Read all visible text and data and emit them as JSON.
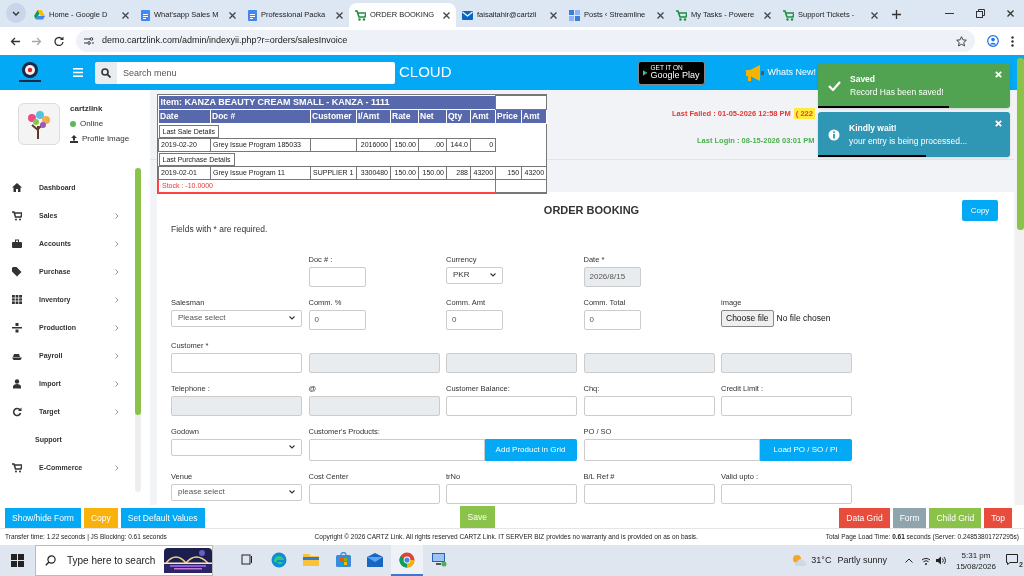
{
  "browser": {
    "tabs": [
      {
        "title": "Home - Google D",
        "kind": "drive",
        "selected": false
      },
      {
        "title": "What'sapp Sales M",
        "kind": "doc",
        "selected": false
      },
      {
        "title": "Professional Packa",
        "kind": "doc",
        "selected": false
      },
      {
        "title": "ORDER BOOKING",
        "kind": "cart",
        "selected": true
      },
      {
        "title": "faisaltahir@cartzli",
        "kind": "mail",
        "selected": false
      },
      {
        "title": "Posts ‹ Streamline",
        "kind": "site",
        "selected": false
      },
      {
        "title": "My Tasks - Powere",
        "kind": "cart",
        "selected": false
      },
      {
        "title": "Support Tickets - ",
        "kind": "cart",
        "selected": false
      }
    ],
    "url": "demo.cartzlink.com/admin/indexyii.php?r=orders/salesInvoice"
  },
  "header": {
    "search_placeholder": "Search menu",
    "cloud": "CLOUD",
    "play_small": "GET IT ON",
    "play_big": "Google Play",
    "whats_new": "Whats New!"
  },
  "sidebar": {
    "user": "cartzlink",
    "status": "Online",
    "profile_link": "Profile Image",
    "items": [
      {
        "label": "Dashboard",
        "kind": "home",
        "has_submenu": false
      },
      {
        "label": "Sales",
        "kind": "cart",
        "has_submenu": true
      },
      {
        "label": "Accounts",
        "kind": "briefcase",
        "has_submenu": true
      },
      {
        "label": "Purchase",
        "kind": "tag",
        "has_submenu": true
      },
      {
        "label": "Inventory",
        "kind": "grid",
        "has_submenu": true
      },
      {
        "label": "Production",
        "kind": "sitemap",
        "has_submenu": true
      },
      {
        "label": "Payroll",
        "kind": "ship",
        "has_submenu": true
      },
      {
        "label": "Import",
        "kind": "user",
        "has_submenu": true
      },
      {
        "label": "Target",
        "kind": "refresh",
        "has_submenu": true
      },
      {
        "label": "Support",
        "kind": "none",
        "has_submenu": false
      },
      {
        "label": "E-Commerce",
        "kind": "cart",
        "has_submenu": true
      }
    ]
  },
  "item_popup": {
    "title": "Item: KANZA BEAUTY CREAM SMALL - KANZA - 1111",
    "columns": [
      "Date",
      "Doc #",
      "Customer",
      "I/Amt",
      "Rate",
      "Net",
      "Qty",
      "Amt",
      "Price",
      "Amt"
    ],
    "sections": [
      {
        "label": "Last Sale Details",
        "row": {
          "date": "2019-02-20",
          "doc_no": "Grey Issue Program 185033",
          "i_amt": "2016000",
          "rate": "150.00",
          "net": ".00",
          "qty": "144.0",
          "amt": "0"
        }
      },
      {
        "label": "Last Purchase Details",
        "row": {
          "date": "2019-02-01",
          "doc_no": "Grey Issue Program 11",
          "customer": "SUPPLIER 1",
          "i_amt": "3300480",
          "rate": "150.00",
          "net": "150.00",
          "qty": "288",
          "amt": "43200",
          "price": "150",
          "price_amt": "43200"
        }
      }
    ],
    "stock": "Stock : -10.0000"
  },
  "login_info": {
    "failed": "Last Failed : 01-05-2026 12:58 PM",
    "failed_days": "( 222",
    "last_login": "Last Login : 08-15-2026 03:01 PM"
  },
  "toasts": [
    {
      "kind": "success",
      "title": "Saved",
      "message": "Record Has been saved!",
      "level": 0.68
    },
    {
      "kind": "info",
      "title": "Kindly wait!",
      "message": "your entry is being processed...",
      "level": 0.56
    }
  ],
  "form": {
    "title": "ORDER BOOKING",
    "copy": "Copy",
    "note": "Fields with * are required.",
    "rows": [
      [
        {
          "kind": "blank"
        },
        {
          "kind": "small_input",
          "label": "Doc # :"
        },
        {
          "kind": "small_select",
          "label": "Currency",
          "value": "PKR"
        },
        {
          "kind": "small_readonly",
          "label": "Date *",
          "value": "2026/8/15"
        },
        {
          "kind": "blank"
        }
      ],
      [
        {
          "kind": "select",
          "label": "Salesman",
          "value": "Please select"
        },
        {
          "kind": "small_input",
          "label": "Comm. %",
          "value": "0"
        },
        {
          "kind": "small_input",
          "label": "Comm. Amt",
          "value": "0"
        },
        {
          "kind": "small_input",
          "label": "Comm. Total",
          "value": "0"
        },
        {
          "kind": "file",
          "label": "image",
          "button": "Choose file",
          "value": "No file chosen"
        }
      ],
      [
        {
          "kind": "input",
          "label": "Customer *"
        },
        {
          "kind": "readonly"
        },
        {
          "kind": "readonly"
        },
        {
          "kind": "readonly"
        },
        {
          "kind": "readonly"
        }
      ],
      [
        {
          "kind": "readonly",
          "label": "Telephone :"
        },
        {
          "kind": "readonly",
          "label": "@"
        },
        {
          "kind": "input",
          "label": "Customer Balance:"
        },
        {
          "kind": "input",
          "label": "Chq:"
        },
        {
          "kind": "input",
          "label": "Credit Limit :"
        }
      ],
      [
        {
          "kind": "select",
          "label": "Godown"
        },
        {
          "kind": "wide_input",
          "label": "Customer's Products:"
        },
        {
          "kind": "button",
          "button": "Add Product in Grid"
        },
        {
          "kind": "wide_input",
          "label": "PO / SO"
        },
        {
          "kind": "button",
          "button": "Load PO / SO / PI"
        }
      ],
      [
        {
          "kind": "select",
          "label": "Venue",
          "value": "please select"
        },
        {
          "kind": "input",
          "label": "Cost Center"
        },
        {
          "kind": "input",
          "label": "trNo"
        },
        {
          "kind": "input",
          "label": "B/L Ref #"
        },
        {
          "kind": "input",
          "label": "Valid upto :"
        }
      ]
    ]
  },
  "actions": {
    "left": [
      {
        "label": "Show/hide Form",
        "kind": "primary"
      },
      {
        "label": "Copy",
        "kind": "warning"
      },
      {
        "label": "Set Default Values",
        "kind": "primary"
      }
    ],
    "save": "Save",
    "right": [
      {
        "label": "Data Grid",
        "kind": "danger"
      },
      {
        "label": "Form",
        "kind": "muted"
      },
      {
        "label": "Child Grid",
        "kind": "success"
      },
      {
        "label": "Top",
        "kind": "danger"
      }
    ]
  },
  "footer": {
    "left": "Transfer time: 1.22 seconds | JS Blocking: 0.61 seconds",
    "center": "Copyright © 2026 CARTZ Link. All rights reserved CARTZ Link. IT SERVER BIZ provides no warranty and is provided on as on basis.",
    "right": "Total Page Load Time: **0.61** seconds (Server: 0.24853801727295s)"
  },
  "taskbar": {
    "search_placeholder": "Type here to search",
    "apps": [
      {
        "kind": "taskview",
        "active": false
      },
      {
        "kind": "edge",
        "active": false
      },
      {
        "kind": "folder",
        "active": false
      },
      {
        "kind": "store",
        "active": false
      },
      {
        "kind": "mail",
        "active": false
      },
      {
        "kind": "chrome",
        "active": true
      },
      {
        "kind": "remote",
        "active": false
      }
    ],
    "temperature": "31°C",
    "weather": "Partly sunny",
    "time": "5:31 pm",
    "date": "15/08/2026",
    "notifications": "2"
  }
}
